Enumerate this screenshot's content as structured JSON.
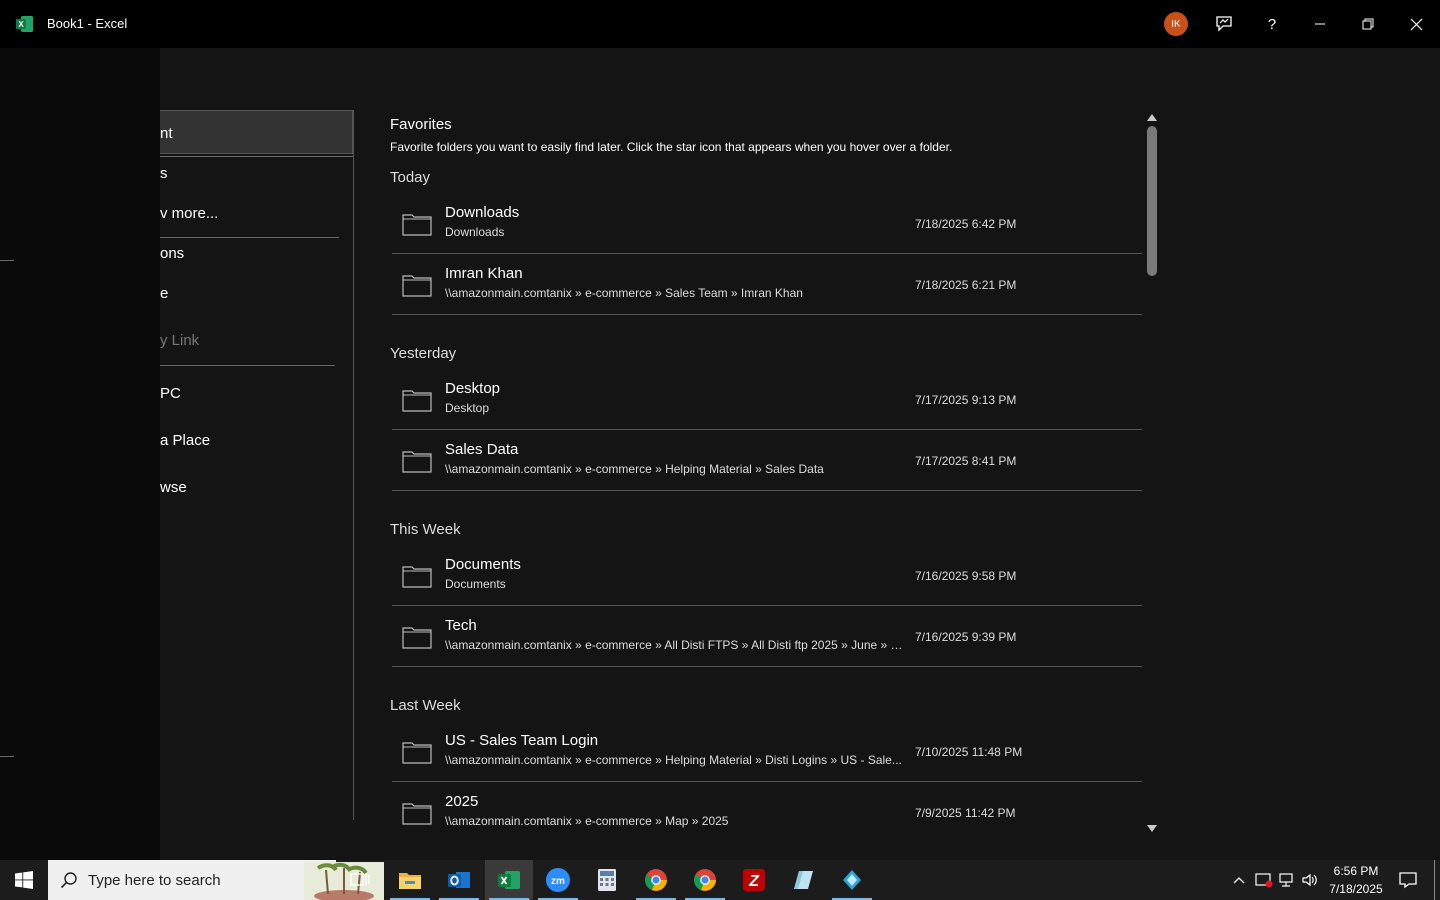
{
  "window": {
    "title": "Book1  -  Excel",
    "avatar_initials": "IK",
    "help_label": "?"
  },
  "side_menu": {
    "items": [
      {
        "label": "nt"
      },
      {
        "label": "s"
      },
      {
        "label": "v more..."
      },
      {
        "label": "ons"
      },
      {
        "label": "e"
      },
      {
        "label": "y Link"
      },
      {
        "label": "PC"
      },
      {
        "label": "a Place"
      },
      {
        "label": "wse"
      }
    ]
  },
  "favorites": {
    "title": "Favorites",
    "description": "Favorite folders you want to easily find later. Click the star icon that appears when you hover over a folder."
  },
  "groups": [
    {
      "label": "Today"
    },
    {
      "label": "Yesterday"
    },
    {
      "label": "This Week"
    },
    {
      "label": "Last Week"
    }
  ],
  "folders": [
    {
      "name": "Downloads",
      "path": "Downloads",
      "date": "7/18/2025 6:42 PM"
    },
    {
      "name": "Imran Khan",
      "path": "\\\\amazonmain.comtanix » e-commerce » Sales Team » Imran Khan",
      "date": "7/18/2025 6:21 PM"
    },
    {
      "name": "Desktop",
      "path": "Desktop",
      "date": "7/17/2025 9:13 PM"
    },
    {
      "name": "Sales Data",
      "path": "\\\\amazonmain.comtanix » e-commerce » Helping Material » Sales Data",
      "date": "7/17/2025 8:41 PM"
    },
    {
      "name": "Documents",
      "path": "Documents",
      "date": "7/16/2025 9:58 PM"
    },
    {
      "name": "Tech",
      "path": "\\\\amazonmain.comtanix » e-commerce » All Disti FTPS » All Disti ftp 2025 » June » S...",
      "date": "7/16/2025 9:39 PM"
    },
    {
      "name": "US - Sales Team Login",
      "path": "\\\\amazonmain.comtanix » e-commerce » Helping Material » Disti Logins » US - Sale...",
      "date": "7/10/2025 11:48 PM"
    },
    {
      "name": "2025",
      "path": "\\\\amazonmain.comtanix » e-commerce » Map » 2025",
      "date": "7/9/2025 11:42 PM"
    }
  ],
  "taskbar": {
    "search_placeholder": "Type here to search",
    "time": "6:56 PM",
    "date": "7/18/2025"
  },
  "colors": {
    "excel_green": "#107c41",
    "avatar": "#c8511b",
    "taskbar_accent": "#76b9ed"
  }
}
